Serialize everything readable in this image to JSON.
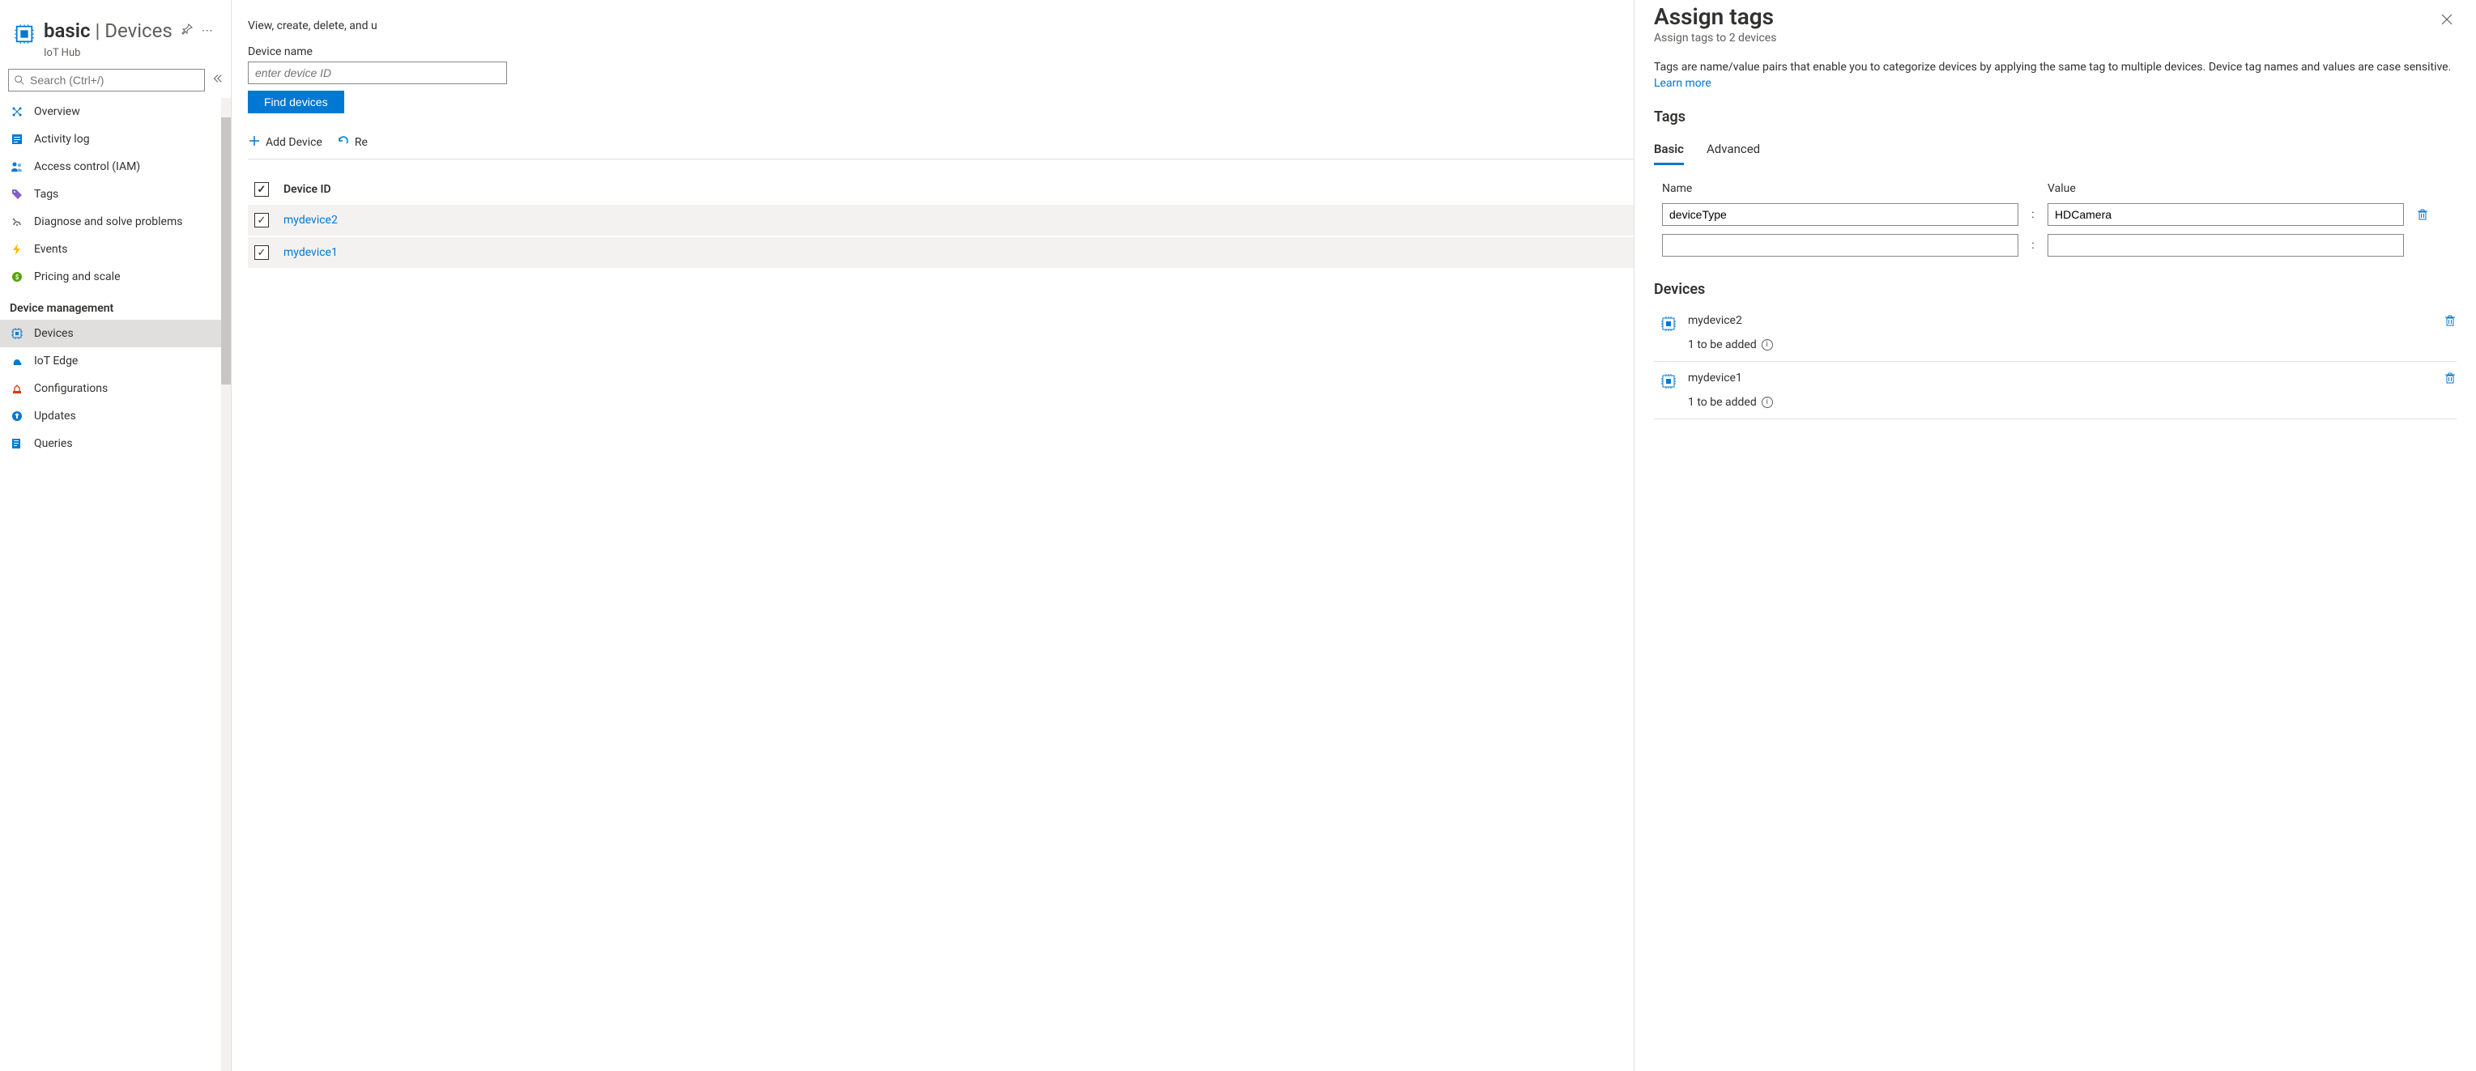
{
  "header": {
    "title_left": "basic",
    "title_sep": " | ",
    "title_right": "Devices",
    "subtitle": "IoT Hub"
  },
  "search": {
    "placeholder": "Search (Ctrl+/)"
  },
  "nav": {
    "items": [
      {
        "label": "Overview",
        "icon": "overview"
      },
      {
        "label": "Activity log",
        "icon": "activitylog"
      },
      {
        "label": "Access control (IAM)",
        "icon": "iam"
      },
      {
        "label": "Tags",
        "icon": "tags"
      },
      {
        "label": "Diagnose and solve problems",
        "icon": "diagnose"
      },
      {
        "label": "Events",
        "icon": "events"
      },
      {
        "label": "Pricing and scale",
        "icon": "pricing"
      }
    ],
    "section_header": "Device management",
    "dm_items": [
      {
        "label": "Devices",
        "icon": "devices",
        "active": true
      },
      {
        "label": "IoT Edge",
        "icon": "iotedge"
      },
      {
        "label": "Configurations",
        "icon": "configurations"
      },
      {
        "label": "Updates",
        "icon": "updates"
      },
      {
        "label": "Queries",
        "icon": "queries"
      }
    ]
  },
  "main": {
    "description": "View, create, delete, and u",
    "device_name_label": "Device name",
    "device_name_placeholder": "enter device ID",
    "find_button": "Find devices",
    "toolbar": {
      "add": "Add Device",
      "refresh": "Re"
    },
    "table": {
      "header": "Device ID",
      "rows": [
        {
          "id": "mydevice2"
        },
        {
          "id": "mydevice1"
        }
      ]
    }
  },
  "panel": {
    "title": "Assign tags",
    "subtitle": "Assign tags to 2 devices",
    "description_1": "Tags are name/value pairs that enable you to categorize devices by applying the same tag to multiple devices. Device tag names and values are case sensitive. ",
    "learn_more": "Learn more",
    "tags_heading": "Tags",
    "tabs": {
      "basic": "Basic",
      "advanced": "Advanced"
    },
    "columns": {
      "name": "Name",
      "value": "Value"
    },
    "tag_rows": [
      {
        "name": "deviceType",
        "value": "HDCamera"
      },
      {
        "name": "",
        "value": ""
      }
    ],
    "devices_heading": "Devices",
    "device_entries": [
      {
        "name": "mydevice2",
        "sub": "1 to be added"
      },
      {
        "name": "mydevice1",
        "sub": "1 to be added"
      }
    ]
  }
}
